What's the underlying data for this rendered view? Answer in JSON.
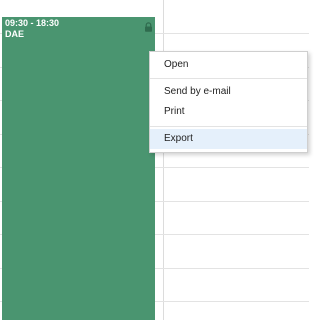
{
  "event": {
    "time_range": "09:30 - 18:30",
    "title": "DAE",
    "color": "#4a9570",
    "status_icon": "lock-icon"
  },
  "context_menu": {
    "items": [
      {
        "label": "Open"
      },
      {
        "label": "Send by e-mail"
      },
      {
        "label": "Print"
      },
      {
        "label": "Export",
        "highlighted": true
      }
    ]
  },
  "colors": {
    "menu_highlight": "#e5f0fb",
    "grid_line": "#e3e3e3"
  }
}
